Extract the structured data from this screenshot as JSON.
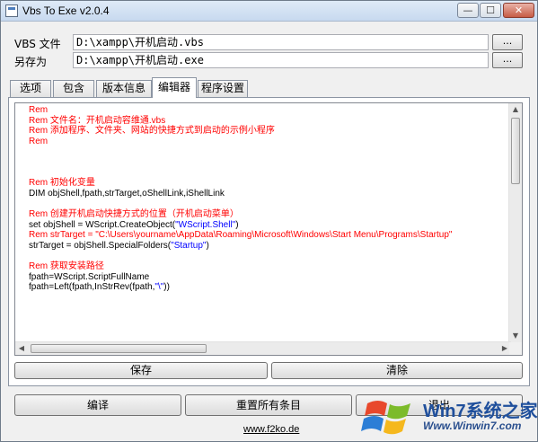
{
  "window": {
    "title": "Vbs To Exe v2.0.4",
    "min_glyph": "—",
    "max_glyph": "☐",
    "close_glyph": "✕"
  },
  "fields": {
    "vbs_label": "VBS 文件",
    "vbs_value": "D:\\xampp\\开机启动.vbs",
    "saveas_label": "另存为",
    "saveas_value": "D:\\xampp\\开机启动.exe",
    "browse_label": "..."
  },
  "tabs": [
    {
      "label": "选项",
      "active": false
    },
    {
      "label": "包含",
      "active": false
    },
    {
      "label": "版本信息",
      "active": false
    },
    {
      "label": "编辑器",
      "active": true
    },
    {
      "label": "程序设置",
      "active": false
    }
  ],
  "editor": {
    "lines": [
      {
        "parts": [
          {
            "text": "Rem",
            "color": "red"
          }
        ]
      },
      {
        "parts": [
          {
            "text": "Rem 文件名：开机启动容维通.vbs",
            "color": "red"
          }
        ]
      },
      {
        "parts": [
          {
            "text": "Rem 添加程序、文件夹、网站的快捷方式到启动的示例小程序",
            "color": "red"
          }
        ]
      },
      {
        "parts": [
          {
            "text": "Rem",
            "color": "red"
          }
        ]
      },
      {
        "parts": []
      },
      {
        "parts": []
      },
      {
        "parts": []
      },
      {
        "parts": [
          {
            "text": "Rem 初始化变量",
            "color": "red"
          }
        ]
      },
      {
        "parts": [
          {
            "text": "DIM objShell,fpath,strTarget,oShellLink,iShellLink",
            "color": "black"
          }
        ]
      },
      {
        "parts": []
      },
      {
        "parts": [
          {
            "text": "Rem 创建开机启动快捷方式的位置（开机启动菜单）",
            "color": "red"
          }
        ]
      },
      {
        "parts": [
          {
            "text": "set objShell = WScript.CreateObject(",
            "color": "black"
          },
          {
            "text": "\"WScript.Shell\"",
            "color": "blue"
          },
          {
            "text": ")",
            "color": "black"
          }
        ]
      },
      {
        "parts": [
          {
            "text": "Rem strTarget = \"C:\\Users\\yourname\\AppData\\Roaming\\Microsoft\\Windows\\Start Menu\\Programs\\Startup\"",
            "color": "red"
          }
        ]
      },
      {
        "parts": [
          {
            "text": "strTarget = objShell.SpecialFolders(",
            "color": "black"
          },
          {
            "text": "\"Startup\"",
            "color": "blue"
          },
          {
            "text": ")",
            "color": "black"
          }
        ]
      },
      {
        "parts": []
      },
      {
        "parts": [
          {
            "text": "Rem 获取安装路径",
            "color": "red"
          }
        ]
      },
      {
        "parts": [
          {
            "text": "fpath=WScript.ScriptFullName",
            "color": "black"
          }
        ]
      },
      {
        "parts": [
          {
            "text": "fpath=Left(fpath,InStrRev(fpath,",
            "color": "black"
          },
          {
            "text": "\"\\\"",
            "color": "blue"
          },
          {
            "text": "))",
            "color": "black"
          }
        ]
      }
    ]
  },
  "buttons": {
    "save": "保存",
    "clear": "清除",
    "compile": "编译",
    "reset": "重置所有条目",
    "exit": "退出"
  },
  "footer_link": "www.f2ko.de",
  "watermark": {
    "brand": "Win7系统之家",
    "url": "Www.Winwin7.com"
  }
}
